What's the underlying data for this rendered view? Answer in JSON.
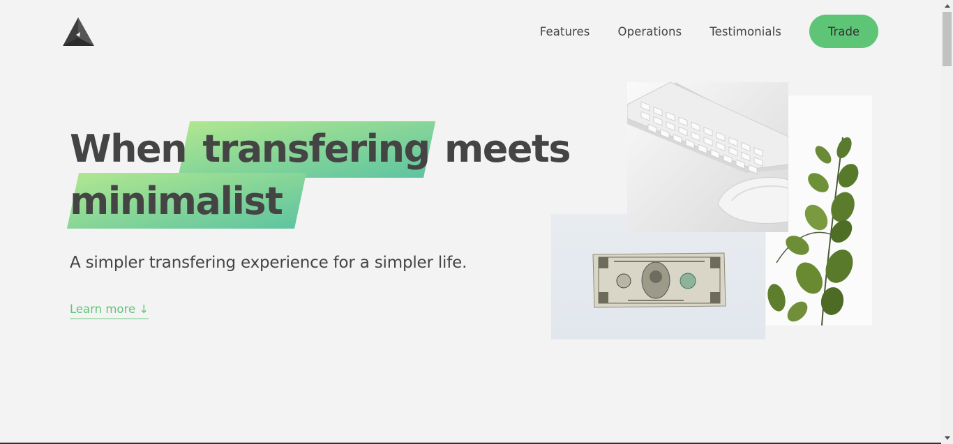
{
  "nav": {
    "links": [
      "Features",
      "Operations",
      "Testimonials"
    ],
    "cta_label": "Trade"
  },
  "hero": {
    "heading_line1_pre": "When",
    "heading_highlight": "transfering",
    "heading_line1_post": "meets",
    "heading_line2": "minimalist",
    "subtitle": "A simpler transfering experience for a simpler life.",
    "learn_more": "Learn more ↓"
  },
  "images": {
    "keyboard": "keyboard-and-mouse-photo",
    "plant": "eucalyptus-plant-photo",
    "dollar": "one-dollar-bill-photo"
  },
  "colors": {
    "background": "#f3f3f3",
    "accent_green": "#5ec576",
    "text": "#444444",
    "highlight_gradient_start": "#b0e790",
    "highlight_gradient_end": "#5ec4a0"
  }
}
